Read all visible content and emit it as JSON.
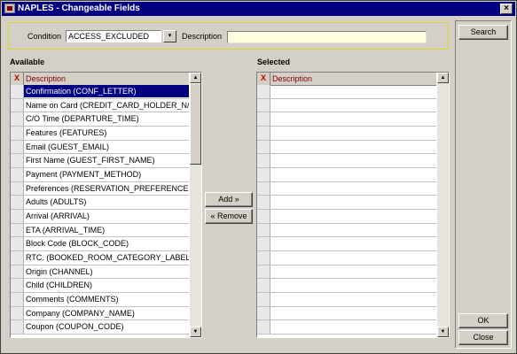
{
  "window": {
    "title": "NAPLES - Changeable Fields",
    "close_glyph": "×"
  },
  "condition": {
    "label": "Condition",
    "value": "ACCESS_EXCLUDED",
    "dropdown_glyph": "▾"
  },
  "description": {
    "label": "Description",
    "value": ""
  },
  "buttons": {
    "search": "Search",
    "add": "Add »",
    "remove": "« Remove",
    "ok": "OK",
    "close": "Close"
  },
  "available": {
    "label": "Available",
    "header_x": "X",
    "header_desc": "Description",
    "items": [
      "Confirmation (CONF_LETTER)",
      "Name on Card (CREDIT_CARD_HOLDER_N/",
      "C/O Time (DEPARTURE_TIME)",
      "Features (FEATURES)",
      "Email (GUEST_EMAIL)",
      "First Name (GUEST_FIRST_NAME)",
      "Payment (PAYMENT_METHOD)",
      "Preferences (RESERVATION_PREFERENCE",
      "Adults (ADULTS)",
      "Arrival (ARRIVAL)",
      "ETA (ARRIVAL_TIME)",
      "Block Code (BLOCK_CODE)",
      "RTC. (BOOKED_ROOM_CATEGORY_LABEL)",
      "Origin (CHANNEL)",
      "Child (CHILDREN)",
      "Comments (COMMENTS)",
      "Company (COMPANY_NAME)",
      "Coupon (COUPON_CODE)"
    ]
  },
  "selected": {
    "label": "Selected",
    "header_x": "X",
    "header_desc": "Description",
    "items": [
      "",
      "",
      "",
      "",
      "",
      "",
      "",
      "",
      "",
      "",
      "",
      "",
      "",
      "",
      "",
      "",
      "",
      ""
    ]
  },
  "colors": {
    "title_bar": "#000080",
    "selection": "#000080",
    "selected_row": "#008080",
    "frame": "#d4d0c8"
  },
  "icons": {
    "app": "app-icon",
    "scroll_up": "scroll-up-icon",
    "scroll_down": "scroll-down-icon"
  }
}
